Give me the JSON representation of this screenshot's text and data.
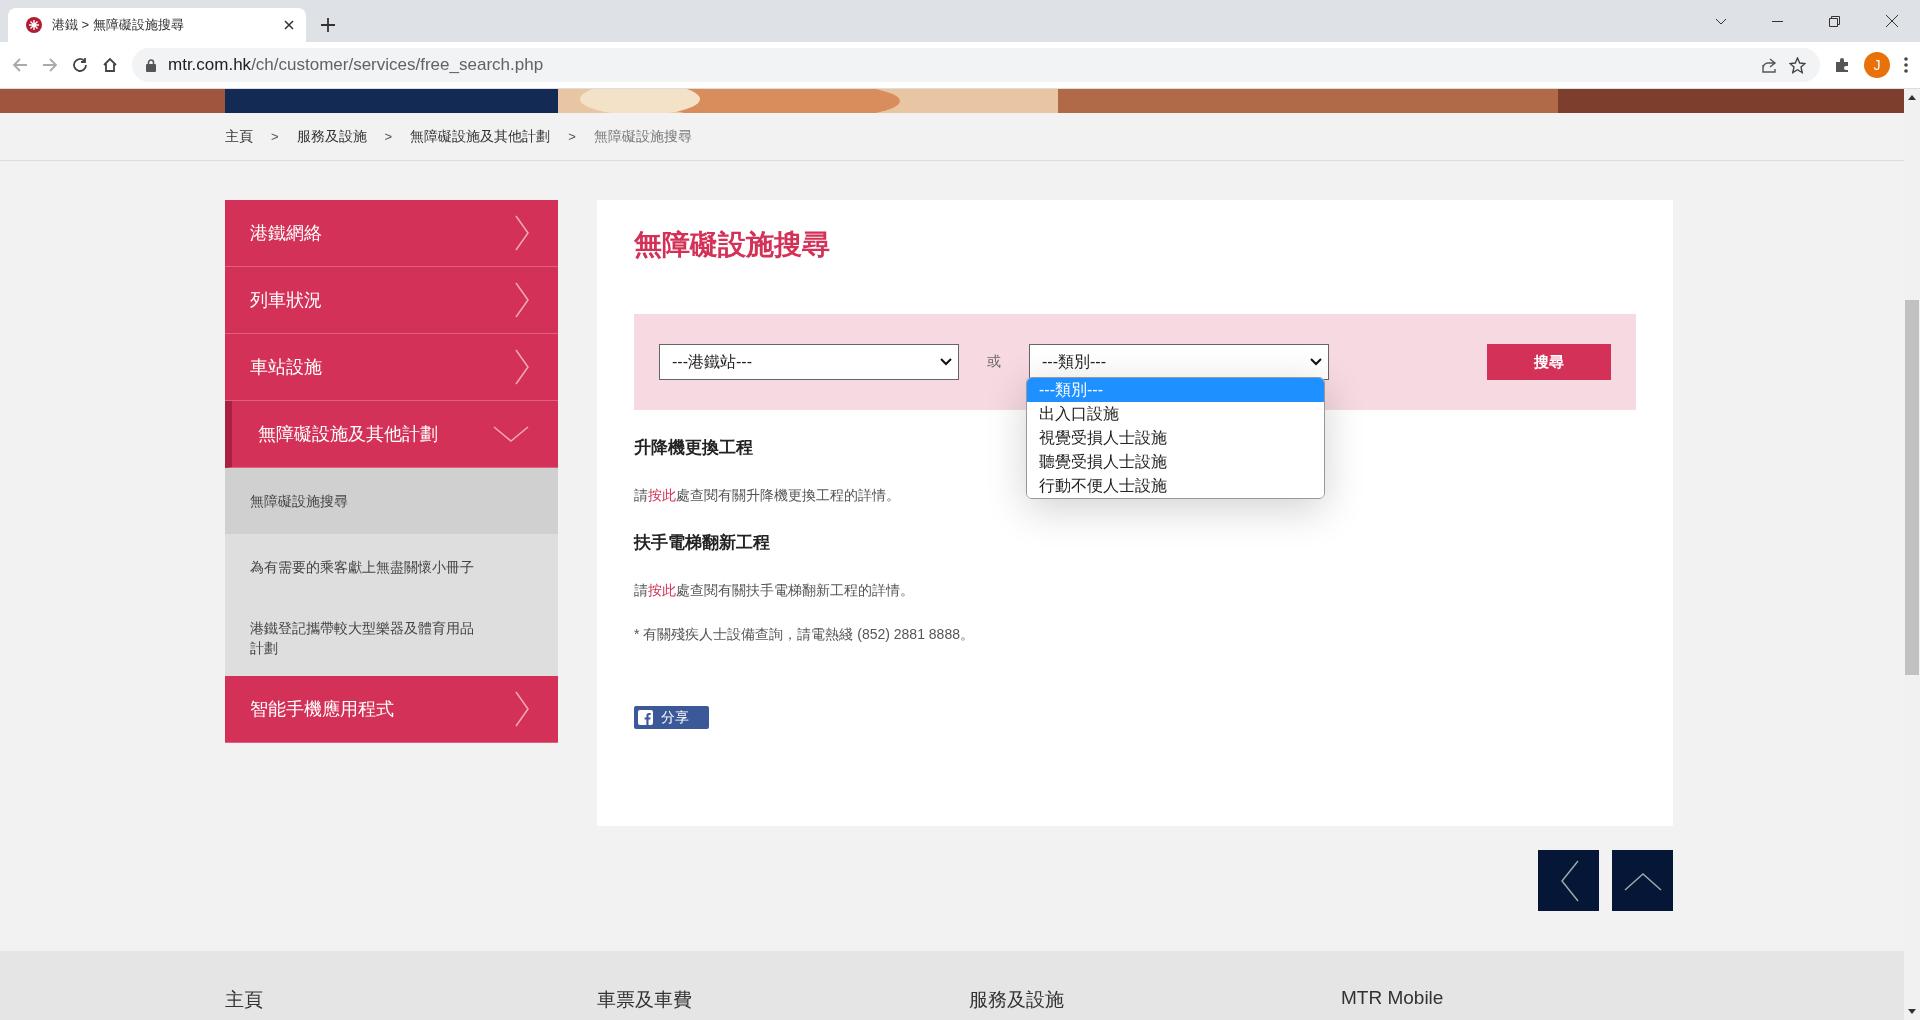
{
  "browser": {
    "tab_title": "港鐵 > 無障礙設施搜尋",
    "url_host": "mtr.com.hk",
    "url_path": "/ch/customer/services/free_search.php",
    "avatar": "J"
  },
  "breadcrumb": [
    {
      "label": "主頁",
      "current": false
    },
    {
      "label": "服務及設施",
      "current": false
    },
    {
      "label": "無障礙設施及其他計劃",
      "current": false
    },
    {
      "label": "無障礙設施搜尋",
      "current": true
    }
  ],
  "breadcrumb_separator": ">",
  "sidebar": [
    {
      "kind": "main",
      "label": "港鐵網絡",
      "expanded": false
    },
    {
      "kind": "main",
      "label": "列車狀況",
      "expanded": false
    },
    {
      "kind": "main",
      "label": "車站設施",
      "expanded": false
    },
    {
      "kind": "main",
      "label": "無障礙設施及其他計劃",
      "expanded": true
    },
    {
      "kind": "sub",
      "label": "無障礙設施搜尋",
      "selected": true
    },
    {
      "kind": "sub",
      "label": "為有需要的乘客獻上無盡關懷小冊子",
      "selected": false
    },
    {
      "kind": "sub",
      "label": "港鐵登記攜帶較大型樂器及體育用品計劃",
      "selected": false
    },
    {
      "kind": "main",
      "label": "智能手機應用程式",
      "expanded": false
    }
  ],
  "content": {
    "title": "無障礙設施搜尋",
    "search": {
      "station_select": "---港鐵站---",
      "or_label": "或",
      "category_select": "---類別---",
      "button": "搜尋",
      "category_options": [
        {
          "label": "---類別---",
          "selected": true
        },
        {
          "label": "出入口設施",
          "selected": false
        },
        {
          "label": "視覺受損人士設施",
          "selected": false
        },
        {
          "label": "聽覺受損人士設施",
          "selected": false
        },
        {
          "label": "行動不便人士設施",
          "selected": false
        }
      ]
    },
    "sections": [
      {
        "heading": "升降機更換工程",
        "before": "請",
        "link": "按此",
        "after": "處查閱有關升降機更換工程的詳情。"
      },
      {
        "heading": "扶手電梯翻新工程",
        "before": "請",
        "link": "按此",
        "after": "處查閱有關扶手電梯翻新工程的詳情。"
      }
    ],
    "note": "* 有關殘疾人士設備查詢，請電熱綫 (852) 2881 8888。",
    "share": "分享"
  },
  "footer": [
    "主頁",
    "車票及車費",
    "服務及設施",
    "MTR Mobile"
  ]
}
